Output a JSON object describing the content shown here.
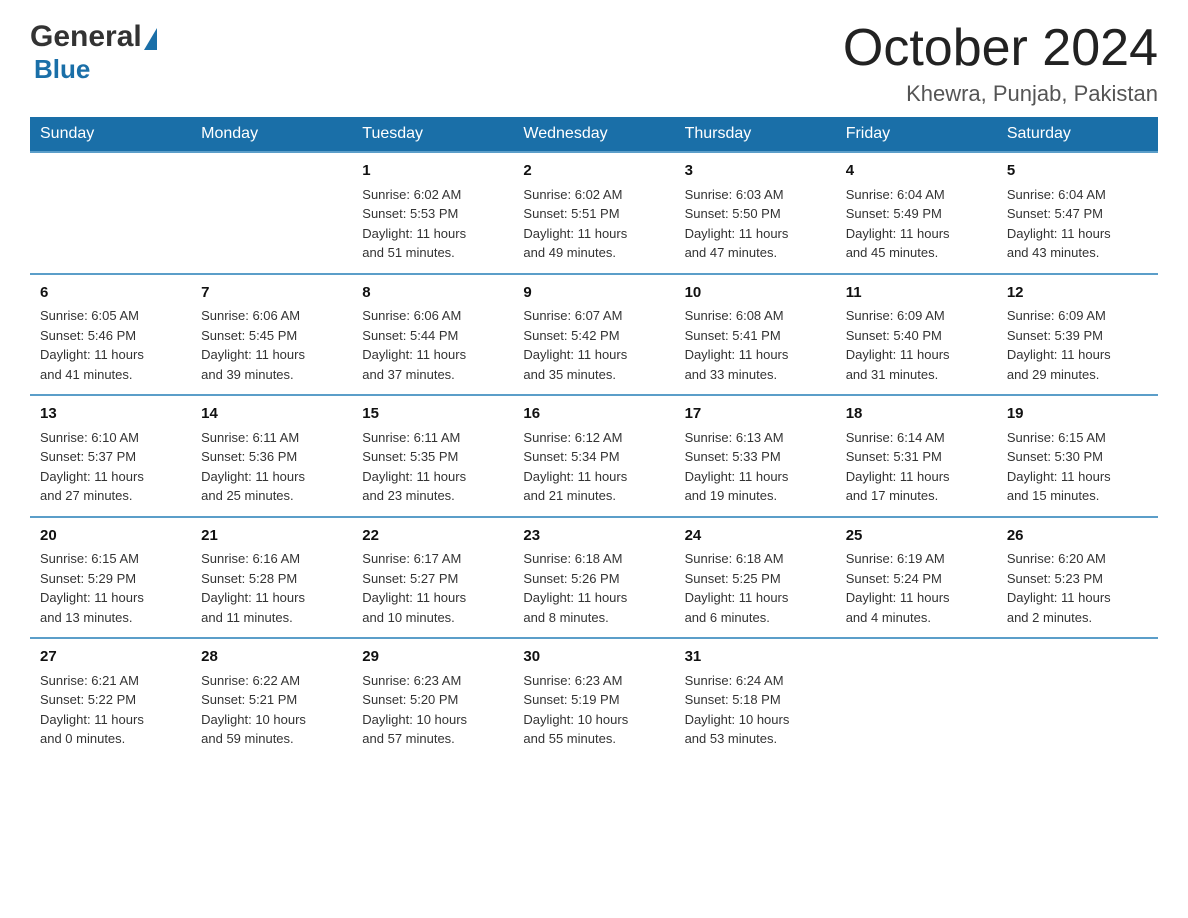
{
  "header": {
    "month_title": "October 2024",
    "location": "Khewra, Punjab, Pakistan"
  },
  "logo": {
    "general": "General",
    "blue": "Blue"
  },
  "weekdays": [
    "Sunday",
    "Monday",
    "Tuesday",
    "Wednesday",
    "Thursday",
    "Friday",
    "Saturday"
  ],
  "weeks": [
    [
      {
        "day": "",
        "info": ""
      },
      {
        "day": "",
        "info": ""
      },
      {
        "day": "1",
        "info": "Sunrise: 6:02 AM\nSunset: 5:53 PM\nDaylight: 11 hours\nand 51 minutes."
      },
      {
        "day": "2",
        "info": "Sunrise: 6:02 AM\nSunset: 5:51 PM\nDaylight: 11 hours\nand 49 minutes."
      },
      {
        "day": "3",
        "info": "Sunrise: 6:03 AM\nSunset: 5:50 PM\nDaylight: 11 hours\nand 47 minutes."
      },
      {
        "day": "4",
        "info": "Sunrise: 6:04 AM\nSunset: 5:49 PM\nDaylight: 11 hours\nand 45 minutes."
      },
      {
        "day": "5",
        "info": "Sunrise: 6:04 AM\nSunset: 5:47 PM\nDaylight: 11 hours\nand 43 minutes."
      }
    ],
    [
      {
        "day": "6",
        "info": "Sunrise: 6:05 AM\nSunset: 5:46 PM\nDaylight: 11 hours\nand 41 minutes."
      },
      {
        "day": "7",
        "info": "Sunrise: 6:06 AM\nSunset: 5:45 PM\nDaylight: 11 hours\nand 39 minutes."
      },
      {
        "day": "8",
        "info": "Sunrise: 6:06 AM\nSunset: 5:44 PM\nDaylight: 11 hours\nand 37 minutes."
      },
      {
        "day": "9",
        "info": "Sunrise: 6:07 AM\nSunset: 5:42 PM\nDaylight: 11 hours\nand 35 minutes."
      },
      {
        "day": "10",
        "info": "Sunrise: 6:08 AM\nSunset: 5:41 PM\nDaylight: 11 hours\nand 33 minutes."
      },
      {
        "day": "11",
        "info": "Sunrise: 6:09 AM\nSunset: 5:40 PM\nDaylight: 11 hours\nand 31 minutes."
      },
      {
        "day": "12",
        "info": "Sunrise: 6:09 AM\nSunset: 5:39 PM\nDaylight: 11 hours\nand 29 minutes."
      }
    ],
    [
      {
        "day": "13",
        "info": "Sunrise: 6:10 AM\nSunset: 5:37 PM\nDaylight: 11 hours\nand 27 minutes."
      },
      {
        "day": "14",
        "info": "Sunrise: 6:11 AM\nSunset: 5:36 PM\nDaylight: 11 hours\nand 25 minutes."
      },
      {
        "day": "15",
        "info": "Sunrise: 6:11 AM\nSunset: 5:35 PM\nDaylight: 11 hours\nand 23 minutes."
      },
      {
        "day": "16",
        "info": "Sunrise: 6:12 AM\nSunset: 5:34 PM\nDaylight: 11 hours\nand 21 minutes."
      },
      {
        "day": "17",
        "info": "Sunrise: 6:13 AM\nSunset: 5:33 PM\nDaylight: 11 hours\nand 19 minutes."
      },
      {
        "day": "18",
        "info": "Sunrise: 6:14 AM\nSunset: 5:31 PM\nDaylight: 11 hours\nand 17 minutes."
      },
      {
        "day": "19",
        "info": "Sunrise: 6:15 AM\nSunset: 5:30 PM\nDaylight: 11 hours\nand 15 minutes."
      }
    ],
    [
      {
        "day": "20",
        "info": "Sunrise: 6:15 AM\nSunset: 5:29 PM\nDaylight: 11 hours\nand 13 minutes."
      },
      {
        "day": "21",
        "info": "Sunrise: 6:16 AM\nSunset: 5:28 PM\nDaylight: 11 hours\nand 11 minutes."
      },
      {
        "day": "22",
        "info": "Sunrise: 6:17 AM\nSunset: 5:27 PM\nDaylight: 11 hours\nand 10 minutes."
      },
      {
        "day": "23",
        "info": "Sunrise: 6:18 AM\nSunset: 5:26 PM\nDaylight: 11 hours\nand 8 minutes."
      },
      {
        "day": "24",
        "info": "Sunrise: 6:18 AM\nSunset: 5:25 PM\nDaylight: 11 hours\nand 6 minutes."
      },
      {
        "day": "25",
        "info": "Sunrise: 6:19 AM\nSunset: 5:24 PM\nDaylight: 11 hours\nand 4 minutes."
      },
      {
        "day": "26",
        "info": "Sunrise: 6:20 AM\nSunset: 5:23 PM\nDaylight: 11 hours\nand 2 minutes."
      }
    ],
    [
      {
        "day": "27",
        "info": "Sunrise: 6:21 AM\nSunset: 5:22 PM\nDaylight: 11 hours\nand 0 minutes."
      },
      {
        "day": "28",
        "info": "Sunrise: 6:22 AM\nSunset: 5:21 PM\nDaylight: 10 hours\nand 59 minutes."
      },
      {
        "day": "29",
        "info": "Sunrise: 6:23 AM\nSunset: 5:20 PM\nDaylight: 10 hours\nand 57 minutes."
      },
      {
        "day": "30",
        "info": "Sunrise: 6:23 AM\nSunset: 5:19 PM\nDaylight: 10 hours\nand 55 minutes."
      },
      {
        "day": "31",
        "info": "Sunrise: 6:24 AM\nSunset: 5:18 PM\nDaylight: 10 hours\nand 53 minutes."
      },
      {
        "day": "",
        "info": ""
      },
      {
        "day": "",
        "info": ""
      }
    ]
  ]
}
